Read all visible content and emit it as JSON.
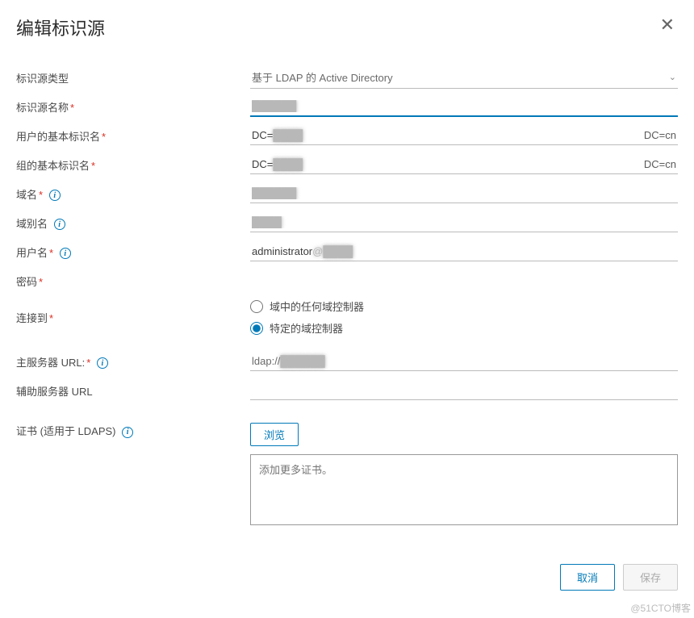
{
  "dialog": {
    "title": "编辑标识源"
  },
  "form": {
    "identitySourceType": {
      "label": "标识源类型",
      "value": "基于 LDAP 的 Active Directory"
    },
    "identitySourceName": {
      "label": "标识源名称",
      "value": ""
    },
    "userDn": {
      "label": "用户的基本标识名",
      "prefix": "DC=",
      "mid": "████",
      "suffix": "DC=cn"
    },
    "groupDn": {
      "label": "组的基本标识名",
      "prefix": "DC=",
      "mid": "████",
      "suffix": "DC=cn"
    },
    "domainName": {
      "label": "域名",
      "value": ""
    },
    "domainAlias": {
      "label": "域别名",
      "value": ""
    },
    "username": {
      "label": "用户名",
      "prefix": "administrator",
      "value": ""
    },
    "password": {
      "label": "密码"
    },
    "connectTo": {
      "label": "连接到",
      "options": [
        {
          "value": "any",
          "label": "域中的任何域控制器"
        },
        {
          "value": "specific",
          "label": "特定的域控制器"
        }
      ],
      "selected": "specific"
    },
    "primaryUrl": {
      "label": "主服务器 URL:",
      "prefix": "ldap://",
      "value": ""
    },
    "secondaryUrl": {
      "label": "辅助服务器 URL"
    },
    "cert": {
      "label": "证书 (适用于 LDAPS)",
      "browse": "浏览",
      "placeholder": "添加更多证书。"
    }
  },
  "footer": {
    "cancel": "取消",
    "save": "保存"
  },
  "watermark": "@51CTO博客"
}
